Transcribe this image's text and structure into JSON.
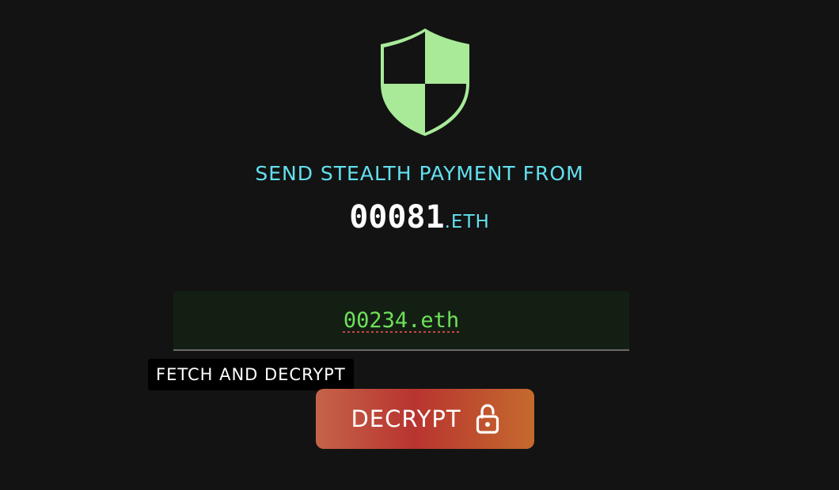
{
  "header": {
    "icon": "shield-icon",
    "title": "SEND STEALTH PAYMENT FROM"
  },
  "sender": {
    "name": "00081",
    "tld": ".ETH"
  },
  "recipient_input": {
    "value": "00234.eth",
    "placeholder": ""
  },
  "tooltip": {
    "text": "FETCH AND DECRYPT"
  },
  "decrypt_button": {
    "label": "DECRYPT",
    "icon": "unlock-icon"
  },
  "colors": {
    "background": "#131313",
    "shield": "#a8ea98",
    "heading": "#62e0ee",
    "input_text": "#6ee05a",
    "button_gradient": [
      "#c5644a",
      "#b8342f",
      "#c56a2e"
    ]
  }
}
